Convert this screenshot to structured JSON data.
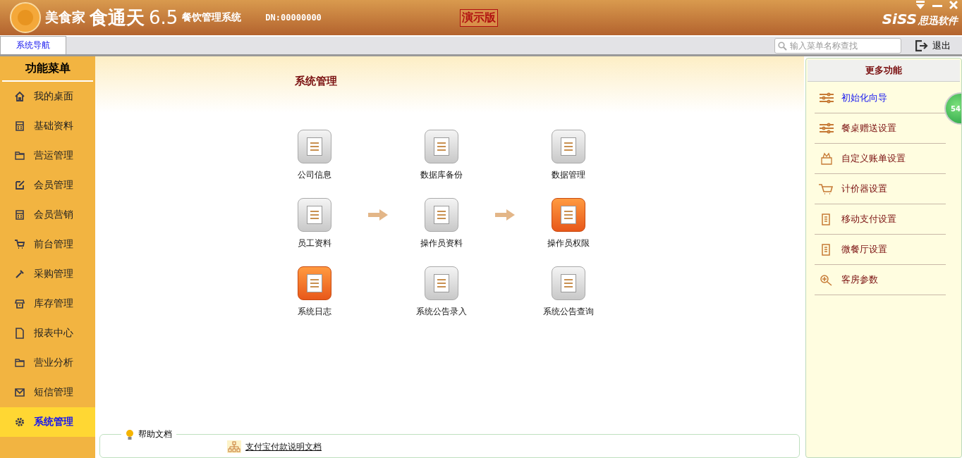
{
  "header": {
    "brand": "美食家",
    "product": "食通天",
    "version": "6.5",
    "subtitle": "餐饮管理系统",
    "dn": "DN:00000000",
    "demo_badge": "演示版",
    "vendor": "SiSS",
    "vendor_cn": "思迅软件"
  },
  "tabs": [
    {
      "label": "系统导航",
      "selected": true
    }
  ],
  "search": {
    "placeholder": "输入菜单名称查找"
  },
  "exit_label": "退出",
  "sidebar": {
    "title": "功能菜单",
    "items": [
      {
        "label": "我的桌面",
        "selected": false
      },
      {
        "label": "基础资料",
        "selected": false
      },
      {
        "label": "营运管理",
        "selected": false
      },
      {
        "label": "会员管理",
        "selected": false
      },
      {
        "label": "会员营销",
        "selected": false
      },
      {
        "label": "前台管理",
        "selected": false
      },
      {
        "label": "采购管理",
        "selected": false
      },
      {
        "label": "库存管理",
        "selected": false
      },
      {
        "label": "报表中心",
        "selected": false
      },
      {
        "label": "营业分析",
        "selected": false
      },
      {
        "label": "短信管理",
        "selected": false
      },
      {
        "label": "系统管理",
        "selected": true
      }
    ]
  },
  "main": {
    "title": "系统管理",
    "rows": [
      {
        "connected": false,
        "items": [
          {
            "label": "公司信息"
          },
          {
            "label": "数据库备份"
          },
          {
            "label": "数据管理"
          }
        ]
      },
      {
        "connected": true,
        "items": [
          {
            "label": "员工资料"
          },
          {
            "label": "操作员资料"
          },
          {
            "label": "操作员权限"
          }
        ]
      },
      {
        "connected": false,
        "items": [
          {
            "label": "系统日志"
          },
          {
            "label": "系统公告录入"
          },
          {
            "label": "系统公告查询"
          }
        ]
      }
    ]
  },
  "help": {
    "title": "帮助文档",
    "links": [
      "支付宝付款说明文档"
    ]
  },
  "more": {
    "title": "更多功能",
    "items": [
      {
        "label": "初始化向导",
        "selected": true
      },
      {
        "label": "餐桌赠送设置",
        "selected": false
      },
      {
        "label": "自定义账单设置",
        "selected": false
      },
      {
        "label": "计价器设置",
        "selected": false
      },
      {
        "label": "移动支付设置",
        "selected": false
      },
      {
        "label": "微餐厅设置",
        "selected": false
      },
      {
        "label": "客房参数",
        "selected": false
      }
    ]
  },
  "floating_badge": "54"
}
